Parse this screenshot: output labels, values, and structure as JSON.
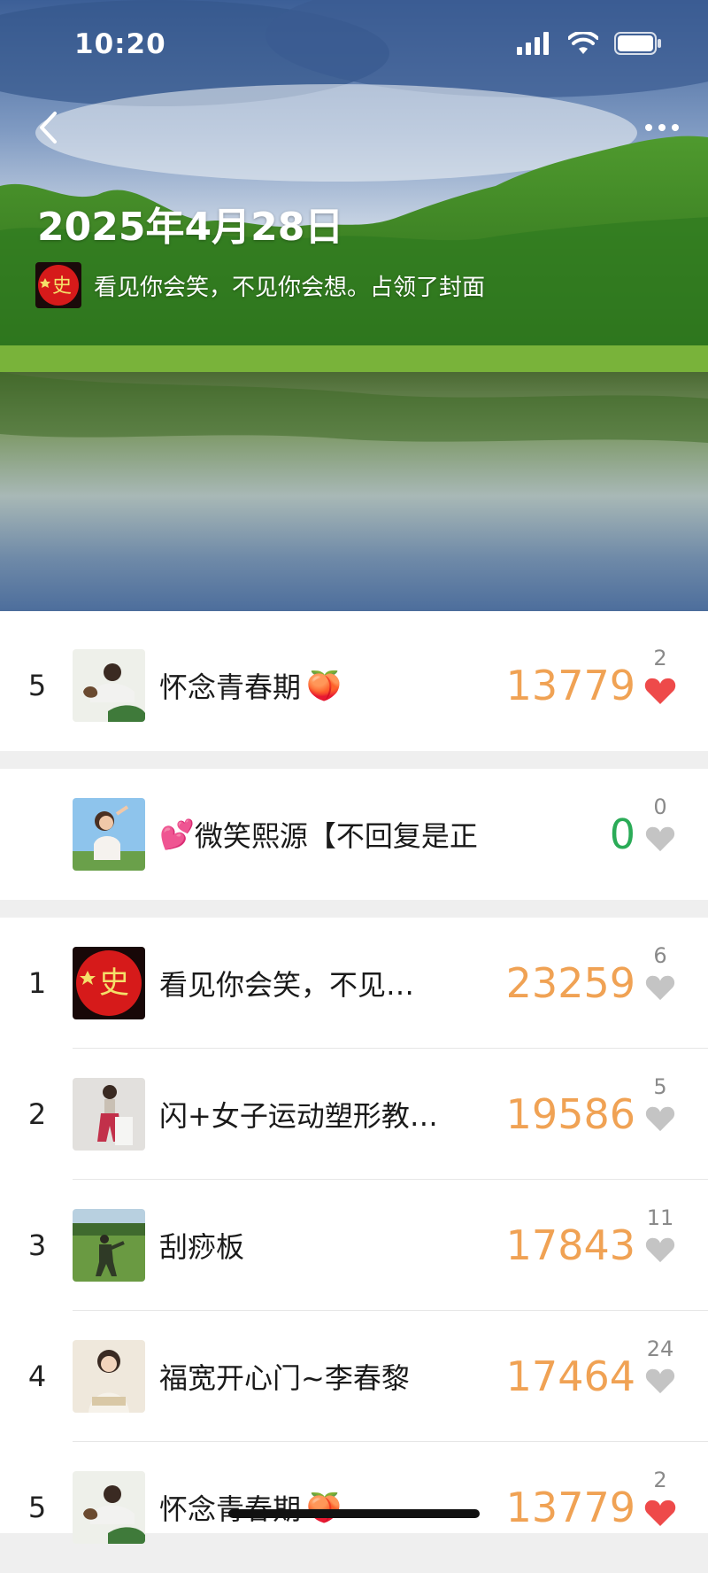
{
  "status_bar": {
    "time": "10:20"
  },
  "cover": {
    "date": "2025年4月28日",
    "owner_text": "看见你会笑，不见你会想。占领了封面",
    "avatar_glyph": "史",
    "back_icon": "chevron-left-icon",
    "more_icon": "more-dots-icon"
  },
  "my_rank": {
    "rank": "5",
    "name": "怀念青春期",
    "emoji": "🍑",
    "steps": "13779",
    "likes": "2",
    "liked": true
  },
  "friend_row": {
    "rank": "",
    "emoji_prefix": "💕",
    "name": "微笑熙源【不回复是正…",
    "steps": "0",
    "likes": "0",
    "liked": false
  },
  "leaderboard": [
    {
      "rank": "1",
      "name": "看见你会笑，不见…",
      "steps": "23259",
      "likes": "6",
      "liked": false,
      "avatar": "red",
      "avatar_glyph": "史"
    },
    {
      "rank": "2",
      "name": "闪+女子运动塑形教…",
      "steps": "19586",
      "likes": "5",
      "liked": false,
      "avatar": "grey"
    },
    {
      "rank": "3",
      "name": "刮痧板",
      "steps": "17843",
      "likes": "11",
      "liked": false,
      "avatar": "field"
    },
    {
      "rank": "4",
      "name": "福宽开心门~李春黎",
      "steps": "17464",
      "likes": "24",
      "liked": false,
      "avatar": "cream"
    },
    {
      "rank": "5",
      "name": "怀念青春期",
      "emoji": "🍑",
      "steps": "13779",
      "likes": "2",
      "liked": true,
      "avatar": "photo"
    }
  ],
  "colors": {
    "steps": "#f0a254",
    "steps_zero": "#2aab57",
    "heart_liked": "#ee4a4a",
    "heart_unliked": "#c4c4c4"
  }
}
